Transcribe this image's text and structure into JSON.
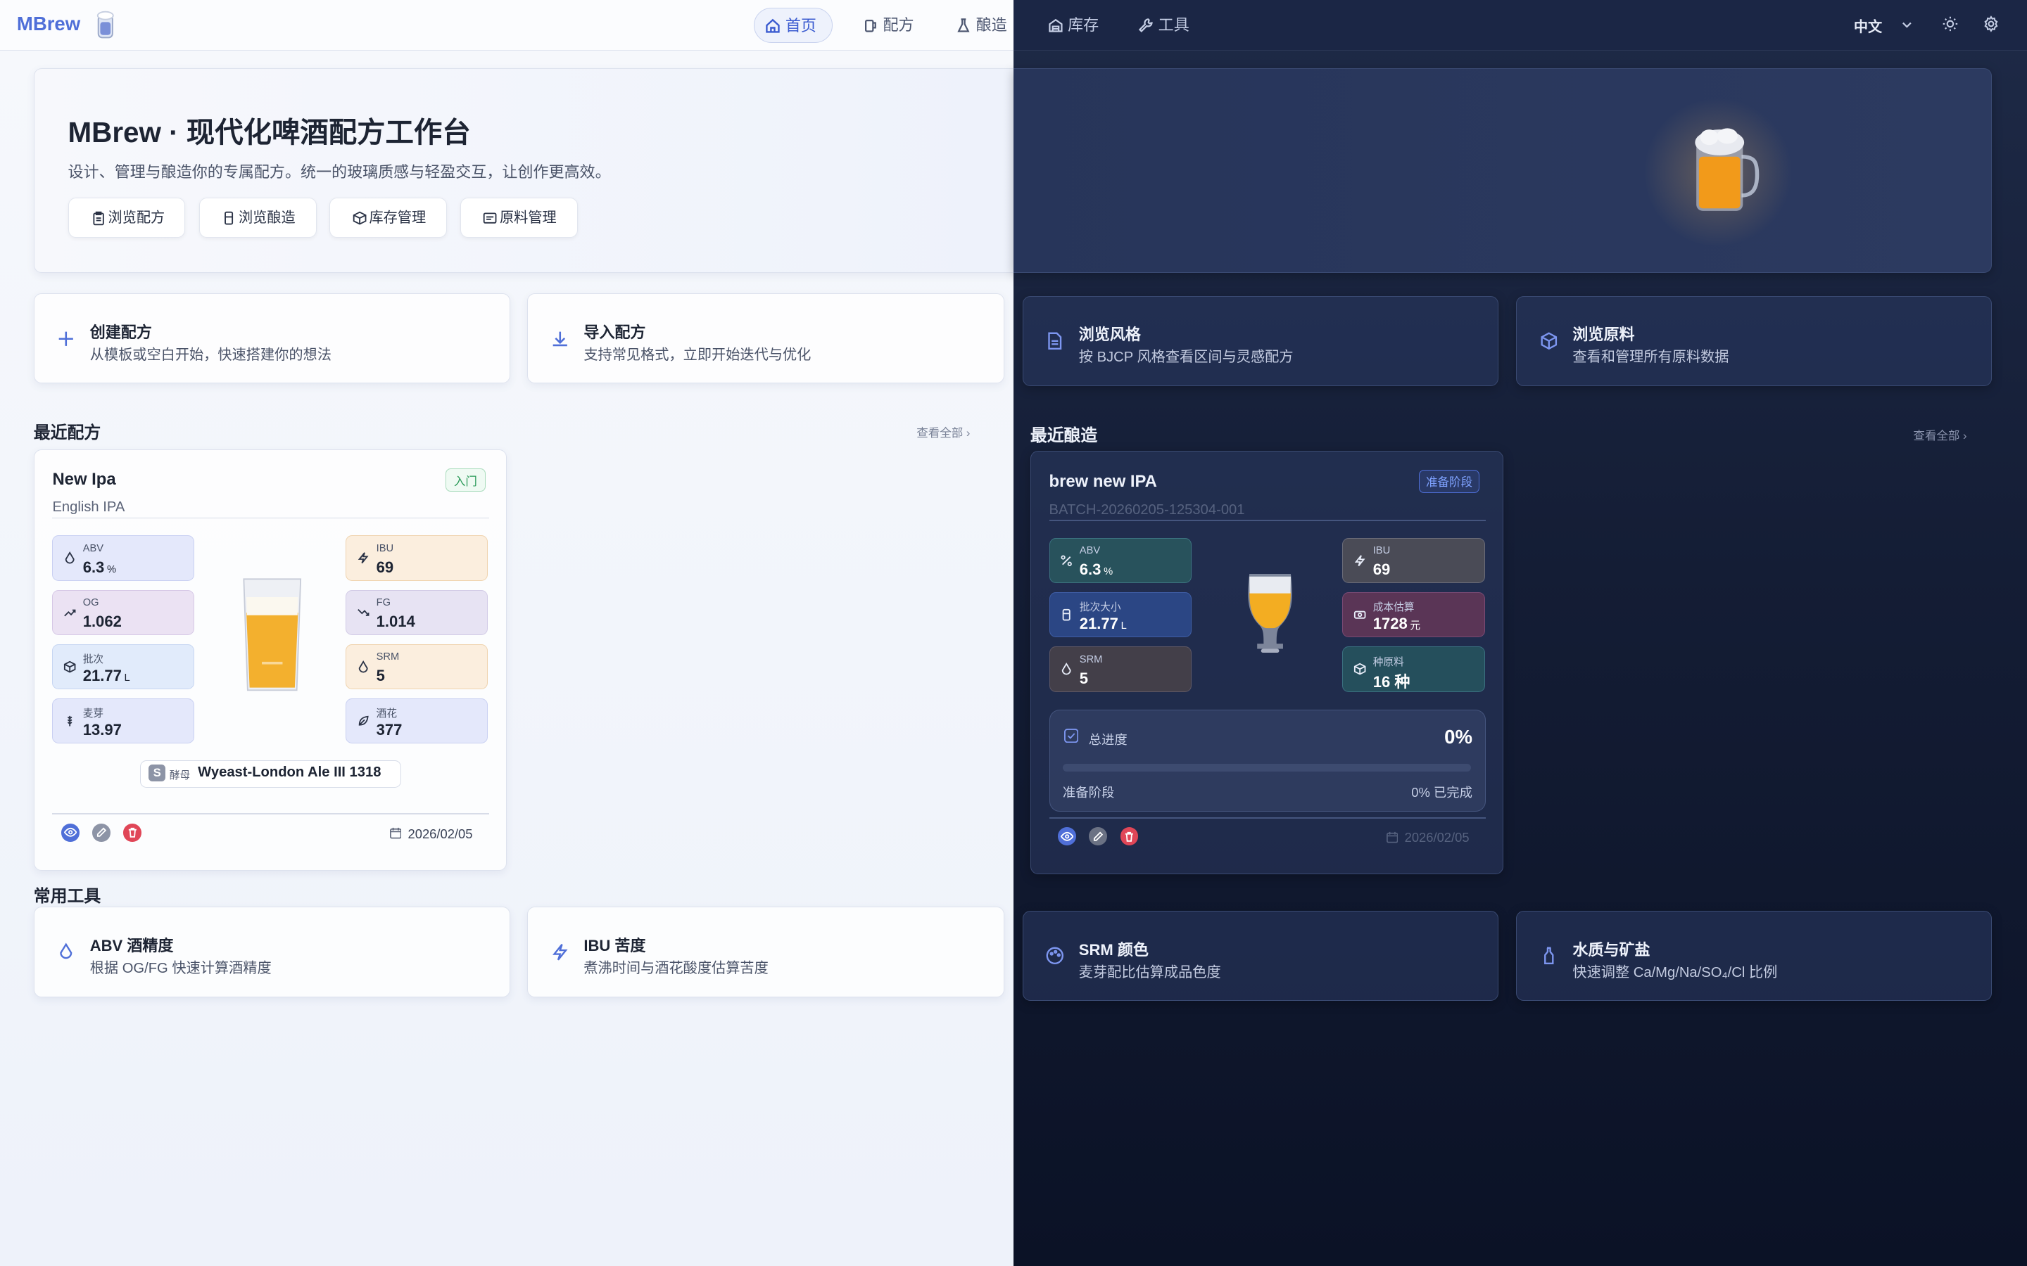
{
  "nav": {
    "logo": "MBrew",
    "home": "首页",
    "recipes": "配方",
    "brew": "酿造",
    "inventory": "库存",
    "tools": "工具",
    "lang": "中文"
  },
  "hero": {
    "title": "MBrew · 现代化啤酒配方工作台",
    "subtitle": "设计、管理与酿造你的专属配方。统一的玻璃质感与轻盈交互，让创作更高效。",
    "buttons": [
      "浏览配方",
      "浏览酿造",
      "库存管理",
      "原料管理"
    ]
  },
  "actions": [
    {
      "title": "创建配方",
      "sub": "从模板或空白开始，快速搭建你的想法"
    },
    {
      "title": "导入配方",
      "sub": "支持常见格式，立即开始迭代与优化"
    },
    {
      "title": "浏览风格",
      "sub": "按 BJCP 风格查看区间与灵感配方"
    },
    {
      "title": "浏览原料",
      "sub": "查看和管理所有原料数据"
    }
  ],
  "recent_recipes": {
    "heading": "最近配方",
    "view_all": "查看全部 ›",
    "card": {
      "name": "New Ipa",
      "level": "入门",
      "style": "English IPA",
      "left": [
        {
          "label": "ABV",
          "value": "6.3",
          "unit": "%"
        },
        {
          "label": "OG",
          "value": "1.062",
          "unit": ""
        },
        {
          "label": "批次",
          "value": "21.77",
          "unit": "L"
        },
        {
          "label": "麦芽",
          "value": "13.97",
          "unit": ""
        }
      ],
      "right": [
        {
          "label": "IBU",
          "value": "69",
          "unit": ""
        },
        {
          "label": "FG",
          "value": "1.014",
          "unit": ""
        },
        {
          "label": "SRM",
          "value": "5",
          "unit": ""
        },
        {
          "label": "酒花",
          "value": "377",
          "unit": ""
        }
      ],
      "yeast_tag": "酵母",
      "yeast": "Wyeast-London Ale III 1318",
      "date": "2026/02/05"
    }
  },
  "recent_brews": {
    "heading": "最近酿造",
    "view_all": "查看全部 ›",
    "card": {
      "name": "brew new IPA",
      "stage_badge": "准备阶段",
      "batch": "BATCH-20260205-125304-001",
      "left": [
        {
          "label": "ABV",
          "value": "6.3",
          "unit": "%"
        },
        {
          "label": "批次大小",
          "value": "21.77",
          "unit": "L"
        },
        {
          "label": "SRM",
          "value": "5",
          "unit": ""
        }
      ],
      "right": [
        {
          "label": "IBU",
          "value": "69",
          "unit": ""
        },
        {
          "label": "成本估算",
          "value": "1728",
          "unit": "元"
        },
        {
          "label": "种原料",
          "value": "16 种",
          "unit": ""
        }
      ],
      "progress_label": "总进度",
      "progress_value": "0%",
      "progress_fraction": 0,
      "stage": "准备阶段",
      "stage_done": "0% 已完成",
      "date": "2026/02/05"
    }
  },
  "tools": {
    "heading": "常用工具",
    "items": [
      {
        "title": "ABV 酒精度",
        "sub": "根据 OG/FG 快速计算酒精度"
      },
      {
        "title": "IBU 苦度",
        "sub": "煮沸时间与酒花酸度估算苦度"
      },
      {
        "title": "SRM 颜色",
        "sub": "麦芽配比估算成品色度"
      },
      {
        "title": "水质与矿盐",
        "sub": "快速调整 Ca/Mg/Na/SO₄/Cl 比例"
      }
    ]
  },
  "colors": {
    "accent": "#4f6fd8",
    "beer": "#f2a91c",
    "dark_bg": "#141d35"
  }
}
